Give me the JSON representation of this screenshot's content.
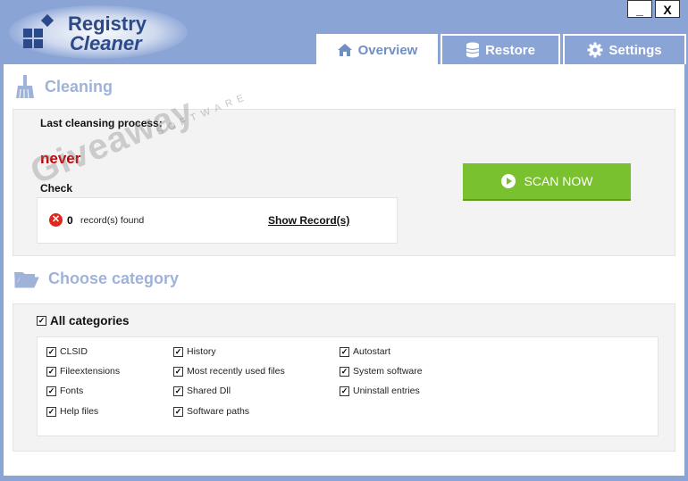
{
  "app": {
    "title_line1": "Registry",
    "title_line2": "Cleaner"
  },
  "window": {
    "minimize_label": "_",
    "close_label": "X"
  },
  "tabs": [
    {
      "label": "Overview",
      "icon": "home-icon",
      "active": true
    },
    {
      "label": "Restore",
      "icon": "database-icon",
      "active": false
    },
    {
      "label": "Settings",
      "icon": "gear-icon",
      "active": false
    }
  ],
  "cleaning": {
    "heading": "Cleaning",
    "last_label": "Last cleansing process:",
    "last_value": "never",
    "check_label": "Check",
    "count": "0",
    "records_text": "record(s) found",
    "show_link": "Show Record(s)",
    "scan_label": "SCAN NOW"
  },
  "category": {
    "heading": "Choose category",
    "all_label": "All categories",
    "items": [
      "CLSID",
      "History",
      "Autostart",
      "Fileextensions",
      "Most recently used files",
      "System software",
      "Fonts",
      "Shared Dll",
      "Uninstall entries",
      "Help files",
      "Software paths"
    ]
  },
  "watermark": {
    "main": "Giveaway",
    "sub": "SOFTWARE"
  },
  "colors": {
    "accent": "#8aa4d6",
    "scan_button": "#79c12e",
    "never_text": "#c00000"
  }
}
